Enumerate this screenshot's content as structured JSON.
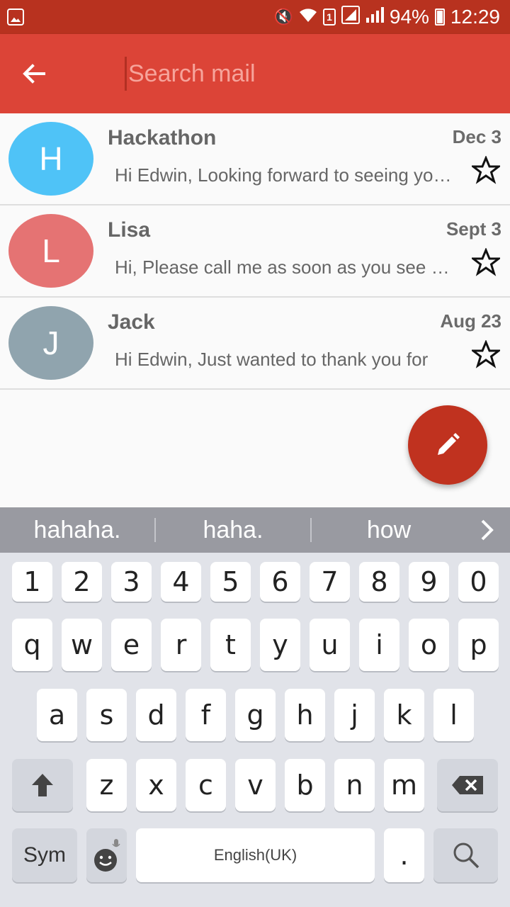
{
  "status_bar": {
    "sim_badge": "1",
    "battery": "94%",
    "time": "12:29"
  },
  "search": {
    "placeholder": "Search mail"
  },
  "mails": [
    {
      "initial": "H",
      "sender": "Hackathon",
      "date": "Dec 3",
      "snippet": "Hi Edwin, Looking forward to seeing you there!",
      "avatar_color": "#4fc3f7"
    },
    {
      "initial": "L",
      "sender": "Lisa",
      "date": "Sept 3",
      "snippet": "Hi, Please call me as soon as you see this",
      "avatar_color": "#e57373"
    },
    {
      "initial": "J",
      "sender": "Jack",
      "date": "Aug 23",
      "snippet": "Hi Edwin, Just wanted to thank you for",
      "avatar_color": "#90a4ae"
    }
  ],
  "suggestions": [
    "hahaha.",
    "haha.",
    "how"
  ],
  "keyboard": {
    "row_numbers": [
      "1",
      "2",
      "3",
      "4",
      "5",
      "6",
      "7",
      "8",
      "9",
      "0"
    ],
    "row1": [
      "q",
      "w",
      "e",
      "r",
      "t",
      "y",
      "u",
      "i",
      "o",
      "p"
    ],
    "row2": [
      "a",
      "s",
      "d",
      "f",
      "g",
      "h",
      "j",
      "k",
      "l"
    ],
    "row3": [
      "z",
      "x",
      "c",
      "v",
      "b",
      "n",
      "m"
    ],
    "sym_label": "Sym",
    "space_label": "English(UK)",
    "period_label": "."
  },
  "colors": {
    "status_bar": "#b8321f",
    "app_bar": "#dc4437",
    "fab": "#c0321f"
  }
}
